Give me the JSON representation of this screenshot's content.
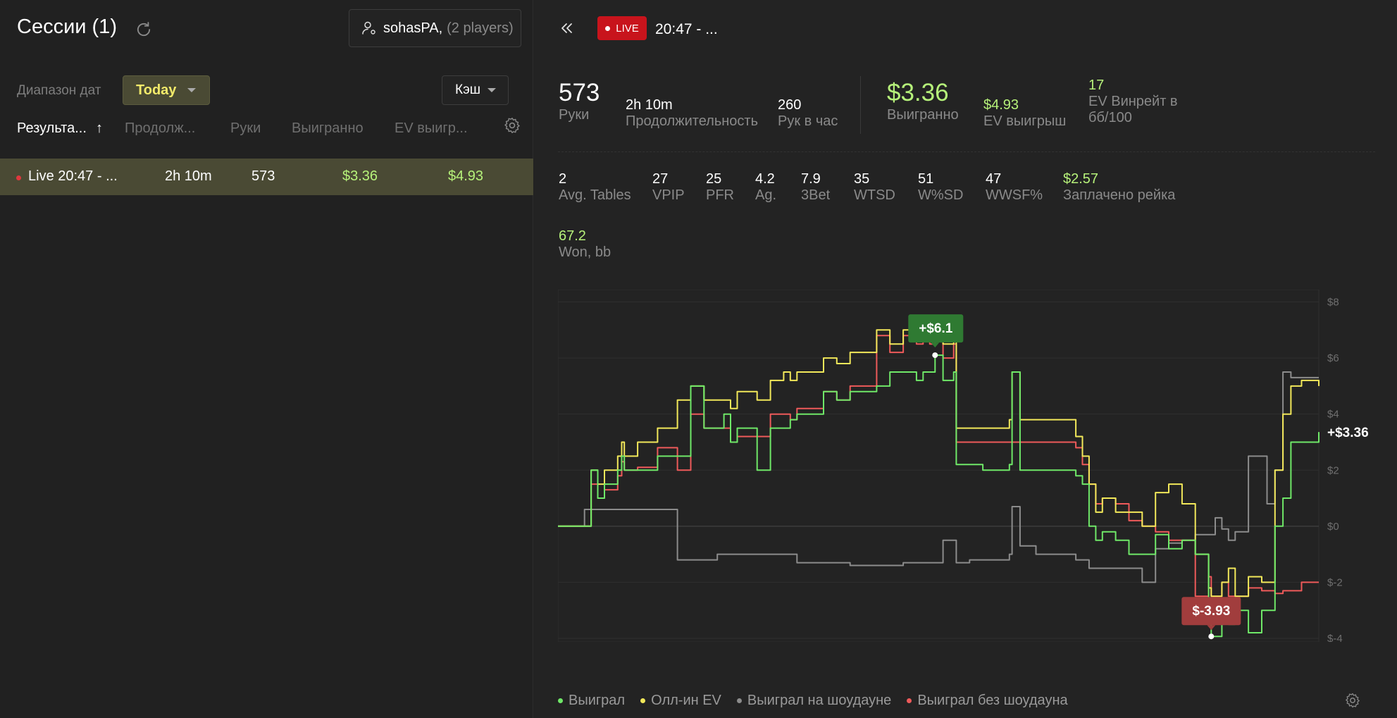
{
  "left": {
    "title": "Сессии (1)",
    "player": {
      "name": "sohasPA,",
      "count": "(2 players)"
    },
    "date_range_label": "Диапазон дат",
    "date_range_value": "Today",
    "game_type": "Кэш",
    "columns": [
      "Результа...",
      "↑",
      "Продолж...",
      "Руки",
      "Выигранно",
      "EV выигр..."
    ],
    "rows": [
      {
        "name": "Live 20:47 - ...",
        "duration": "2h 10m",
        "hands": "573",
        "won": "$3.36",
        "ev": "$4.93"
      }
    ]
  },
  "header": {
    "live_label": "LIVE",
    "session_title": "20:47 - ..."
  },
  "summary": {
    "hands": {
      "value": "573",
      "label": "Руки"
    },
    "duration": {
      "value": "2h 10m",
      "label": "Продолжительность"
    },
    "hands_per_hour": {
      "value": "260",
      "label": "Рук в час"
    },
    "won": {
      "value": "$3.36",
      "label": "Выигранно"
    },
    "ev_won": {
      "value": "$4.93",
      "label": "EV выигрыш"
    },
    "ev_winrate": {
      "value": "17",
      "label_line1": "EV Винрейт в",
      "label_line2": "бб/100"
    }
  },
  "stats": [
    {
      "value": "2",
      "label": "Avg. Tables"
    },
    {
      "value": "27",
      "label": "VPIP"
    },
    {
      "value": "25",
      "label": "PFR"
    },
    {
      "value": "4.2",
      "label": "Ag."
    },
    {
      "value": "7.9",
      "label": "3Bet"
    },
    {
      "value": "35",
      "label": "WTSD"
    },
    {
      "value": "51",
      "label": "W%SD"
    },
    {
      "value": "47",
      "label": "WWSF%"
    },
    {
      "value": "$2.57",
      "label": "Заплачено рейка"
    },
    {
      "value": "67.2",
      "label": "Won, bb"
    }
  ],
  "colors": {
    "won": "#6fe868",
    "allin_ev": "#f2e85a",
    "showdown": "#8c8c8c",
    "non_showdown": "#ee5a5a",
    "accent_green": "#b6f27a",
    "live_red": "#c8141c"
  },
  "chart_data": {
    "type": "line",
    "x_ticks": [
      "0",
      "100",
      "200",
      "300",
      "400",
      "500",
      "573"
    ],
    "y_ticks": [
      "$8",
      "$6",
      "$4",
      "$2",
      "$0",
      "$-2",
      "$-4"
    ],
    "xlim": [
      0,
      573
    ],
    "ylim": [
      -4,
      8
    ],
    "grid": true,
    "legend": "bottom",
    "annotations": {
      "max_label": "+$6.1",
      "max_x": 284,
      "max_y": 6.1,
      "min_label": "$-3.93",
      "min_x": 492,
      "min_y": -3.93,
      "end_label": "+$3.36"
    },
    "series": [
      {
        "name": "Выиграл",
        "color_key": "won",
        "x": [
          0,
          10,
          20,
          25,
          30,
          35,
          45,
          48,
          50,
          60,
          75,
          90,
          100,
          110,
          125,
          130,
          135,
          150,
          160,
          170,
          175,
          180,
          190,
          200,
          210,
          220,
          240,
          250,
          260,
          270,
          275,
          280,
          284,
          290,
          298,
          300,
          320,
          340,
          342,
          348,
          360,
          380,
          390,
          395,
          400,
          405,
          410,
          420,
          430,
          440,
          450,
          460,
          470,
          480,
          490,
          492,
          500,
          505,
          510,
          520,
          530,
          540,
          546,
          552,
          560,
          573
        ],
        "y": [
          0,
          0,
          0,
          2,
          1,
          1.5,
          2,
          2.5,
          2,
          2,
          2.5,
          2.5,
          5,
          3.5,
          4,
          3,
          3.5,
          2,
          3.5,
          3.5,
          3.8,
          4,
          4,
          4.8,
          4.5,
          4.8,
          5,
          5.5,
          5.5,
          5.2,
          5.5,
          5.5,
          6.1,
          5.2,
          5.5,
          2.2,
          2,
          2.2,
          5.5,
          2,
          2,
          2,
          1.8,
          1.5,
          0,
          -0.5,
          -0.2,
          -0.5,
          -1,
          -1,
          -0.3,
          -0.8,
          -0.5,
          -1,
          -3.5,
          -3.93,
          -3,
          -3.5,
          -3,
          -3.8,
          -3,
          0,
          1,
          3,
          3,
          3.36
        ]
      },
      {
        "name": "Олл-ин EV",
        "color_key": "allin_ev",
        "x": [
          0,
          10,
          20,
          25,
          30,
          35,
          45,
          48,
          50,
          60,
          75,
          90,
          100,
          110,
          125,
          130,
          135,
          150,
          160,
          170,
          175,
          180,
          190,
          200,
          210,
          220,
          240,
          250,
          260,
          270,
          275,
          280,
          284,
          290,
          298,
          300,
          320,
          340,
          342,
          348,
          360,
          380,
          390,
          395,
          400,
          405,
          410,
          420,
          430,
          440,
          450,
          460,
          470,
          480,
          490,
          492,
          500,
          505,
          510,
          520,
          530,
          540,
          546,
          552,
          560,
          573
        ],
        "y": [
          0,
          0,
          0,
          2,
          1.5,
          2,
          2.5,
          3,
          2.5,
          3,
          3.5,
          4.5,
          5,
          4.5,
          4.5,
          4.2,
          4.8,
          4.5,
          5.2,
          5.5,
          5.2,
          5.5,
          5.5,
          6,
          5.8,
          6.2,
          7,
          6.5,
          7,
          6.8,
          7,
          6.8,
          7.2,
          6.5,
          7,
          3.5,
          3.5,
          3.8,
          5.5,
          3.8,
          3.8,
          3.8,
          3.2,
          2.5,
          1.5,
          0.5,
          1,
          0.5,
          0.5,
          0,
          1.2,
          1.5,
          0.8,
          -1,
          -2.2,
          -2.5,
          -2,
          -1.5,
          -2.5,
          -1.8,
          -2,
          2,
          4,
          5,
          5.2,
          5
        ]
      },
      {
        "name": "Выиграл на шоудауне",
        "color_key": "showdown",
        "x": [
          0,
          10,
          20,
          30,
          40,
          48,
          55,
          60,
          75,
          88,
          90,
          100,
          120,
          140,
          160,
          180,
          200,
          220,
          240,
          260,
          280,
          290,
          300,
          310,
          320,
          330,
          340,
          342,
          348,
          360,
          380,
          390,
          400,
          410,
          420,
          430,
          440,
          450,
          460,
          470,
          480,
          490,
          495,
          500,
          505,
          510,
          520,
          530,
          534,
          540,
          546,
          552,
          560,
          573
        ],
        "y": [
          0,
          0,
          0.6,
          0.6,
          0.6,
          0.6,
          0.6,
          0.6,
          0.6,
          0.6,
          -1.2,
          -1.2,
          -1,
          -1,
          -1,
          -1.3,
          -1.3,
          -1.4,
          -1.4,
          -1.3,
          -1.3,
          -0.5,
          -1.3,
          -1.2,
          -1.2,
          -1.2,
          -1,
          0.7,
          -0.7,
          -1,
          -1,
          -1.2,
          -1.5,
          -1.5,
          -1.5,
          -1.5,
          -2,
          -0.8,
          -0.6,
          -0.5,
          -0.3,
          -0.3,
          0.3,
          -0.1,
          -0.5,
          -0.2,
          2.5,
          2.5,
          0.8,
          2,
          5.5,
          5.3,
          5.3,
          5.3
        ]
      },
      {
        "name": "Выиграл без шоудауна",
        "color_key": "non_showdown",
        "x": [
          0,
          10,
          20,
          25,
          30,
          35,
          45,
          48,
          50,
          60,
          75,
          90,
          100,
          110,
          125,
          130,
          135,
          150,
          160,
          170,
          175,
          180,
          190,
          200,
          210,
          220,
          240,
          250,
          260,
          270,
          275,
          280,
          284,
          290,
          298,
          300,
          320,
          340,
          342,
          348,
          360,
          380,
          390,
          395,
          400,
          405,
          410,
          420,
          430,
          440,
          450,
          460,
          470,
          480,
          490,
          492,
          500,
          505,
          510,
          520,
          530,
          540,
          546,
          552,
          560,
          573
        ],
        "y": [
          0,
          0,
          0,
          1.5,
          1,
          1.3,
          1.8,
          2.3,
          2,
          2.1,
          2.8,
          2,
          4,
          3.5,
          3.5,
          3,
          3.2,
          3.2,
          4,
          4,
          3.8,
          4.2,
          4.2,
          4.8,
          4.5,
          5,
          6.8,
          6.2,
          6.8,
          6.5,
          6.8,
          6.5,
          6.8,
          6,
          6.5,
          3,
          3,
          3,
          3,
          3,
          3,
          3,
          2.8,
          2.2,
          1.5,
          0.8,
          1,
          0.8,
          0.2,
          0,
          -0.2,
          -0.5,
          -0.5,
          -2.5,
          -1.8,
          -2.5,
          -2,
          -2.5,
          -2.5,
          -2.2,
          -2.3,
          -2.4,
          -2.3,
          -2.3,
          -2,
          -2
        ]
      }
    ]
  },
  "legend": [
    "Выиграл",
    "Олл-ин EV",
    "Выиграл на шоудауне",
    "Выиграл без шоудауна"
  ]
}
